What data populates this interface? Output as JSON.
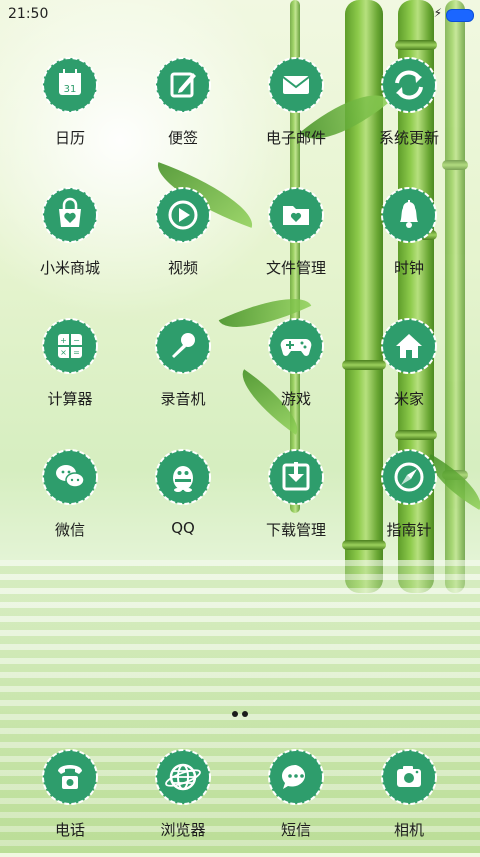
{
  "status_bar": {
    "time": "21:50",
    "charging_icon": "bolt-icon",
    "battery_icon": "battery-icon",
    "battery_color": "#1b66ff"
  },
  "theme": {
    "badge_color": "#2e9d6c",
    "badge_edge": "#ffffff",
    "label_color": "#1d1d1d"
  },
  "apps": [
    {
      "label": "日历",
      "icon": "calendar-icon",
      "day": "31"
    },
    {
      "label": "便签",
      "icon": "notes-icon"
    },
    {
      "label": "电子邮件",
      "icon": "mail-icon"
    },
    {
      "label": "系统更新",
      "icon": "update-icon"
    },
    {
      "label": "小米商城",
      "icon": "shopping-bag-icon"
    },
    {
      "label": "视频",
      "icon": "play-icon"
    },
    {
      "label": "文件管理",
      "icon": "folder-icon"
    },
    {
      "label": "时钟",
      "icon": "bell-icon"
    },
    {
      "label": "计算器",
      "icon": "calculator-icon"
    },
    {
      "label": "录音机",
      "icon": "microphone-icon"
    },
    {
      "label": "游戏",
      "icon": "gamepad-icon"
    },
    {
      "label": "米家",
      "icon": "home-icon"
    },
    {
      "label": "微信",
      "icon": "chat-icon"
    },
    {
      "label": "QQ",
      "icon": "penguin-icon"
    },
    {
      "label": "下载管理",
      "icon": "download-icon"
    },
    {
      "label": "指南针",
      "icon": "compass-icon"
    }
  ],
  "page_indicator": {
    "pages": 2,
    "current": 1
  },
  "dock": [
    {
      "label": "电话",
      "icon": "phone-icon"
    },
    {
      "label": "浏览器",
      "icon": "globe-icon"
    },
    {
      "label": "短信",
      "icon": "message-icon"
    },
    {
      "label": "相机",
      "icon": "camera-icon"
    }
  ]
}
